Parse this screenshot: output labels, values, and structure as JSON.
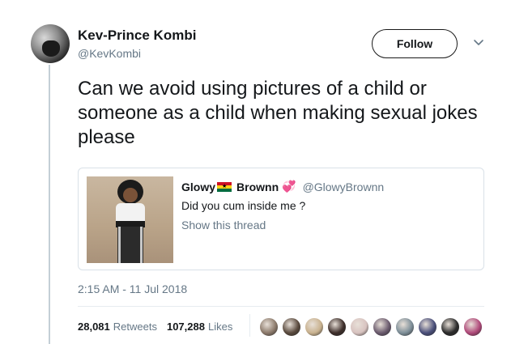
{
  "author": {
    "name": "Kev-Prince Kombi",
    "handle": "@KevKombi"
  },
  "follow_button": "Follow",
  "tweet_text": "Can we avoid using pictures of a child or someone as a child when making sexual jokes please",
  "quote": {
    "name_part1": "Glowy",
    "name_part2": "Brownn",
    "handle": "@GlowyBrownn",
    "text": "Did you cum inside me ?",
    "show_thread": "Show this thread"
  },
  "timestamp": "2:15 AM - 11 Jul 2018",
  "stats": {
    "retweets_count": "28,081",
    "retweets_label": "Retweets",
    "likes_count": "107,288",
    "likes_label": "Likes"
  },
  "liker_avatars": [
    "#8c7a6b",
    "#5a4a3e",
    "#c9b28f",
    "#3d2e2a",
    "#d8c3c0",
    "#6b5b6e",
    "#7e8f99",
    "#4a4f7a",
    "#2b2b2b",
    "#b04a7a"
  ]
}
